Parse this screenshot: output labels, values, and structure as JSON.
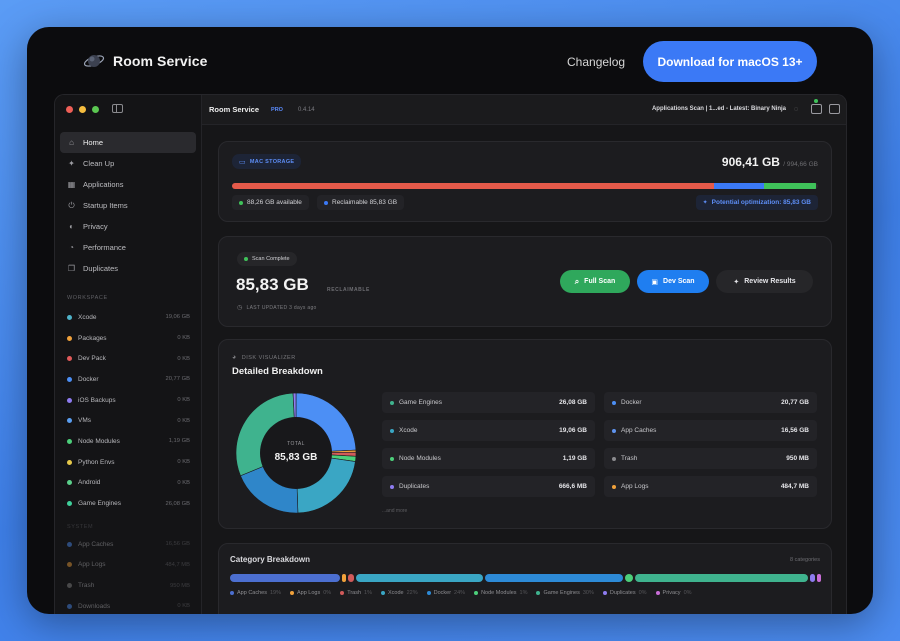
{
  "site": {
    "brand": "Room Service",
    "changelog": "Changelog",
    "download_label": "Download for macOS 13+"
  },
  "sidebar": {
    "nav": [
      {
        "label": "Home",
        "icon": "home-icon",
        "active": true
      },
      {
        "label": "Clean Up",
        "icon": "sparkle-icon"
      },
      {
        "label": "Applications",
        "icon": "grid-icon"
      },
      {
        "label": "Startup Items",
        "icon": "power-icon"
      },
      {
        "label": "Privacy",
        "icon": "privacy-icon"
      },
      {
        "label": "Performance",
        "icon": "gauge-icon"
      },
      {
        "label": "Duplicates",
        "icon": "copy-icon"
      }
    ],
    "workspace_label": "WORKSPACE",
    "workspace": [
      {
        "label": "Xcode",
        "size": "19,06 GB",
        "color": "#4fb3c9"
      },
      {
        "label": "Packages",
        "size": "0 KB",
        "color": "#f0a13b"
      },
      {
        "label": "Dev Pack",
        "size": "0 KB",
        "color": "#e15a5a"
      },
      {
        "label": "Docker",
        "size": "20,77 GB",
        "color": "#4c8ff5"
      },
      {
        "label": "iOS Backups",
        "size": "0 KB",
        "color": "#8e7cf0"
      },
      {
        "label": "VMs",
        "size": "0 KB",
        "color": "#5a9ef0"
      },
      {
        "label": "Node Modules",
        "size": "1,19 GB",
        "color": "#4ccf7a"
      },
      {
        "label": "Python Envs",
        "size": "0 KB",
        "color": "#e6c84a"
      },
      {
        "label": "Android",
        "size": "0 KB",
        "color": "#5bcf8a"
      },
      {
        "label": "Game Engines",
        "size": "26,08 GB",
        "color": "#3fcf9a"
      }
    ],
    "system_label": "SYSTEM",
    "system": [
      {
        "label": "App Caches",
        "size": "16,56 GB",
        "color": "#4c8ff5"
      },
      {
        "label": "App Logs",
        "size": "484,7 MB",
        "color": "#f0a13b"
      },
      {
        "label": "Trash",
        "size": "950 MB",
        "color": "#888888"
      },
      {
        "label": "Downloads",
        "size": "0 KB",
        "color": "#4c8ff5"
      }
    ]
  },
  "titlebar": {
    "app_name": "Room Service",
    "badge": "PRO",
    "version": "0.4.14",
    "status": "Applications Scan | 1...ed - Latest: Binary Ninja"
  },
  "storage": {
    "label": "MAC STORAGE",
    "used": "906,41 GB",
    "total": "/ 994,66 GB",
    "available": "88,26 GB available",
    "reclaimable": "Reclaimable 85,83 GB",
    "optimization": "Potential optimization: 85,83 GB",
    "bar": {
      "used_fraction": 0.822,
      "reclaimable_fraction": 0.086,
      "available_fraction": 0.089
    },
    "colors": {
      "used": "#e55a4a",
      "reclaimable": "#3b79f6",
      "available": "#3fc25a"
    }
  },
  "scan": {
    "badge": "Scan Complete",
    "amount": "85,83 GB",
    "reclaimable_label": "RECLAIMABLE",
    "updated": "LAST UPDATED 3 days ago",
    "full_scan": "Full Scan",
    "dev_scan": "Dev Scan",
    "review": "Review Results",
    "colors": {
      "full": "#2fa85c",
      "dev": "#1f7ef0",
      "review": "#262629"
    }
  },
  "disk": {
    "label": "DISK VISUALIZER",
    "title": "Detailed Breakdown",
    "total_label": "TOTAL",
    "total": "85,83 GB",
    "more": "...and more",
    "items": [
      {
        "label": "Game Engines",
        "value": "26,08 GB",
        "color": "#3fb38e"
      },
      {
        "label": "Docker",
        "value": "20,77 GB",
        "color": "#4c8ff5"
      },
      {
        "label": "Xcode",
        "value": "19,06 GB",
        "color": "#3aa6c4"
      },
      {
        "label": "App Caches",
        "value": "16,56 GB",
        "color": "#5f93ef"
      },
      {
        "label": "Node Modules",
        "value": "1,19 GB",
        "color": "#4ccf7a"
      },
      {
        "label": "Trash",
        "value": "950 MB",
        "color": "#8a8a8e"
      },
      {
        "label": "Duplicates",
        "value": "666,6 MB",
        "color": "#8e7cf0"
      },
      {
        "label": "App Logs",
        "value": "484,7 MB",
        "color": "#f0a13b"
      }
    ],
    "slices_gb": [
      {
        "label": "Docker",
        "value": 20.77,
        "color": "#4c8ff5"
      },
      {
        "label": "App Logs",
        "value": 0.48,
        "color": "#f0a13b"
      },
      {
        "label": "Trash",
        "value": 0.95,
        "color": "#d05a5a"
      },
      {
        "label": "Node Modules",
        "value": 1.19,
        "color": "#4ccf7a"
      },
      {
        "label": "Xcode",
        "value": 19.06,
        "color": "#3aa6c4"
      },
      {
        "label": "App Caches",
        "value": 16.56,
        "color": "#2f86c9"
      },
      {
        "label": "Game Engines",
        "value": 26.08,
        "color": "#3fb38e"
      },
      {
        "label": "Duplicates",
        "value": 0.67,
        "color": "#8e7cf0"
      }
    ]
  },
  "categories": {
    "title": "Category Breakdown",
    "count": "8 categories",
    "segments": [
      {
        "label": "App Caches",
        "pct": "19%",
        "value": 19,
        "color": "#4c6fd0"
      },
      {
        "label": "App Logs",
        "pct": "0%",
        "value": 0.6,
        "color": "#f0a13b"
      },
      {
        "label": "Trash",
        "pct": "1%",
        "value": 1.1,
        "color": "#d05a5a"
      },
      {
        "label": "Xcode",
        "pct": "22%",
        "value": 22,
        "color": "#3aa6c4"
      },
      {
        "label": "Docker",
        "pct": "24%",
        "value": 24,
        "color": "#2d8ad6"
      },
      {
        "label": "Node Modules",
        "pct": "1%",
        "value": 1.4,
        "color": "#4ccf7a"
      },
      {
        "label": "Game Engines",
        "pct": "30%",
        "value": 30,
        "color": "#3fb38e"
      },
      {
        "label": "Duplicates",
        "pct": "0%",
        "value": 0.8,
        "color": "#8e7cf0"
      },
      {
        "label": "Privacy",
        "pct": "0%",
        "value": 0.5,
        "color": "#c86dd6"
      }
    ]
  }
}
